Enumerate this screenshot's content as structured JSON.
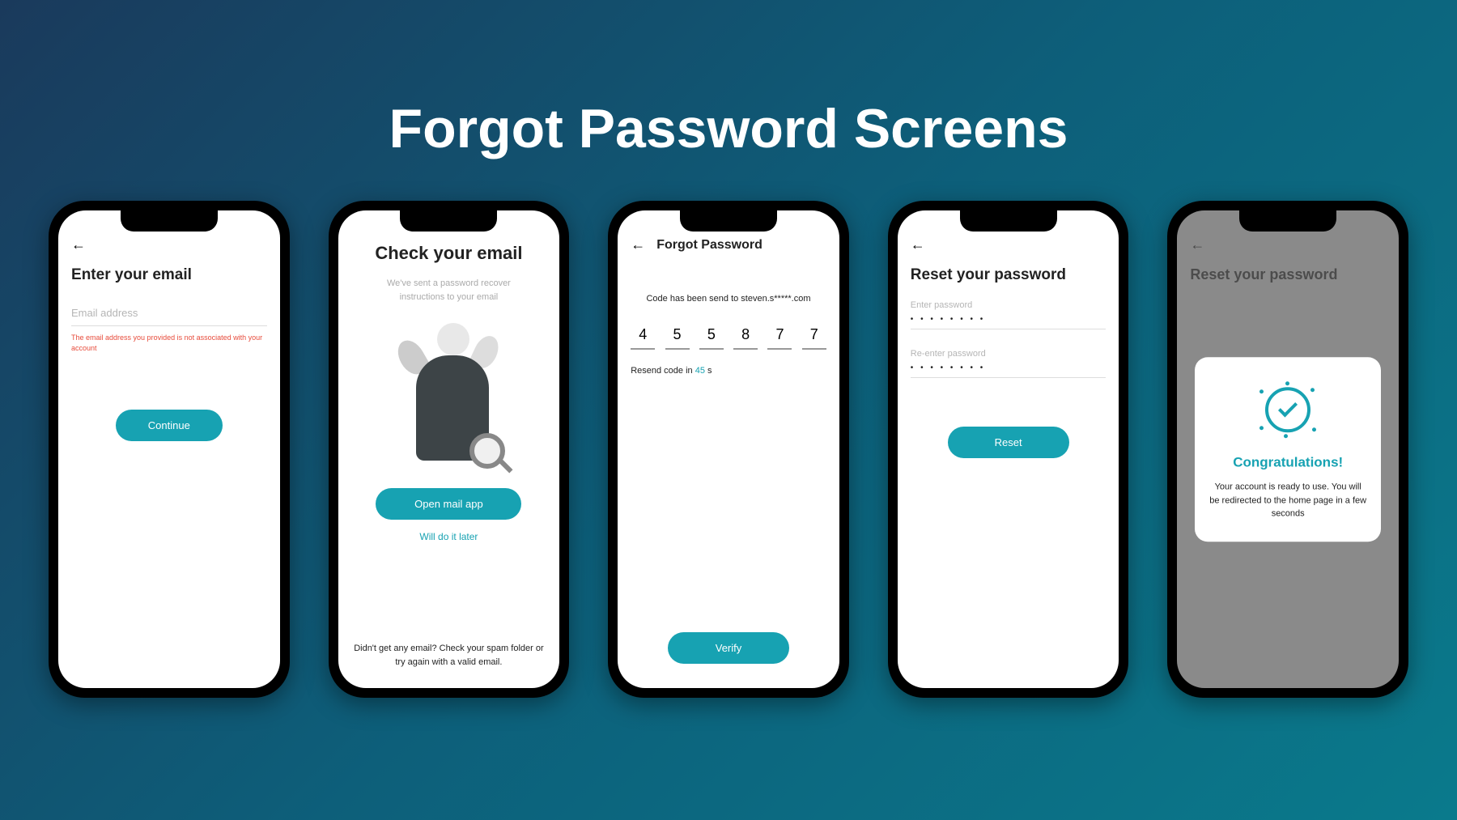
{
  "page_title": "Forgot Password Screens",
  "screen1": {
    "title": "Enter your email",
    "placeholder": "Email address",
    "error": "The email address you provided is not associated with your account",
    "button": "Continue"
  },
  "screen2": {
    "title": "Check your email",
    "subtitle": "We've sent a password recover instructions to your email",
    "button": "Open mail app",
    "link": "Will do it later",
    "footer": "Didn't get any email? Check your spam folder or try again with a valid email."
  },
  "screen3": {
    "header": "Forgot Password",
    "sent_text": "Code has been send to steven.s*****.com",
    "otp": [
      "4",
      "5",
      "5",
      "8",
      "7",
      "7"
    ],
    "resend_prefix": "Resend code in ",
    "resend_time": "45",
    "resend_suffix": " s",
    "button": "Verify"
  },
  "screen4": {
    "title": "Reset your password",
    "label1": "Enter password",
    "value1": "• • • • • • • •",
    "label2": "Re-enter password",
    "value2": "• • • • • • • •",
    "button": "Reset"
  },
  "screen5": {
    "bg_title": "Reset your password",
    "modal_title": "Congratulations!",
    "modal_text": "Your account is ready to use. You will be redirected to the home page in a few seconds"
  }
}
